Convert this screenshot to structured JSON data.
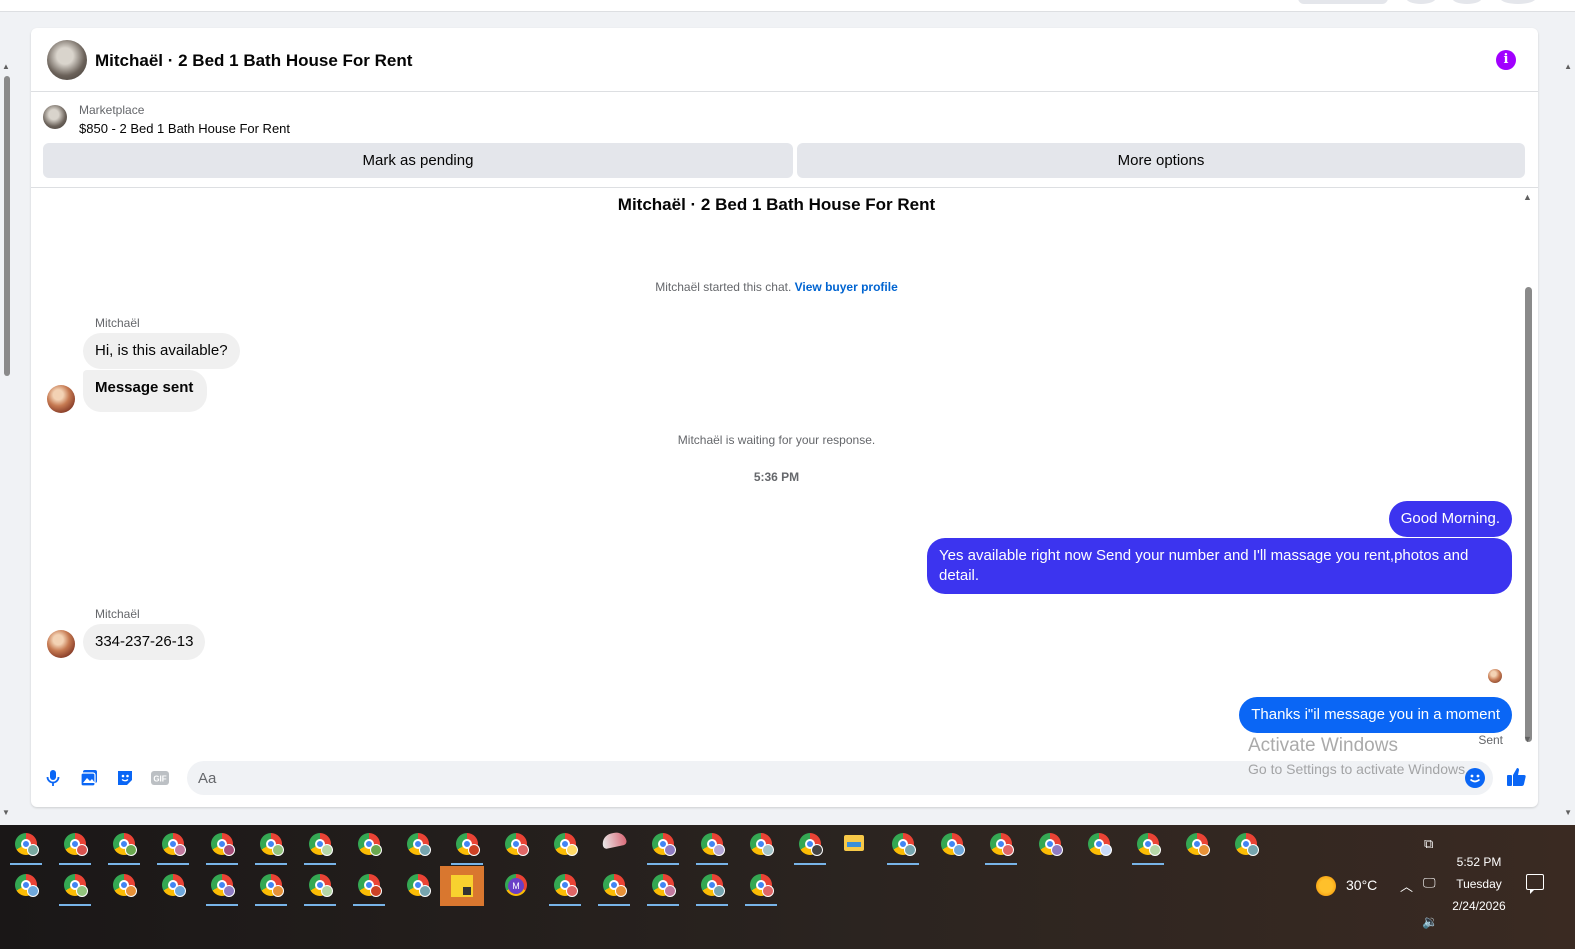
{
  "chat": {
    "header_title": "Mitchaël · 2 Bed 1 Bath House For Rent",
    "info_glyph": "i",
    "marketplace_label": "Marketplace",
    "listing_text": "$850 - 2 Bed 1 Bath House For Rent",
    "mark_pending_label": "Mark as pending",
    "more_options_label": "More options",
    "thread_title": "Mitchaël · 2 Bed 1 Bath House For Rent",
    "started_text": "Mitchaël started this chat.",
    "view_profile_label": "View buyer profile",
    "waiting_text": "Mitchaël is waiting for your response.",
    "timestamp": "5:36 PM",
    "sender_name": "Mitchaël",
    "messages_in_1": [
      "Hi, is this available?",
      "Message sent"
    ],
    "messages_out_1": [
      "Good Morning.",
      "Yes available right now Send your number and I'll massage you rent,photos and detail."
    ],
    "messages_in_2": [
      "334-237-26-13"
    ],
    "messages_out_2": [
      "Thanks i\"il message you in a moment"
    ],
    "sent_status": "Sent",
    "composer_placeholder": "Aa"
  },
  "watermark": {
    "line1": "Activate Windows",
    "line2": "Go to Settings to activate Windows."
  },
  "taskbar": {
    "weather_temp": "30°C",
    "time": "5:52 PM",
    "day": "Tuesday",
    "date": "2/24/2026"
  },
  "icons": {
    "mic": "microphone-icon",
    "photo": "photo-icon",
    "sticker": "sticker-icon",
    "gif": "gif-icon",
    "emoji": "emoji-icon",
    "like": "thumbs-up-icon"
  },
  "colors": {
    "outgoing_bubble": "#3c34ef",
    "outgoing_bubble_latest": "#0a66f5",
    "info_icon": "#a100ff",
    "link": "#0064d1"
  }
}
